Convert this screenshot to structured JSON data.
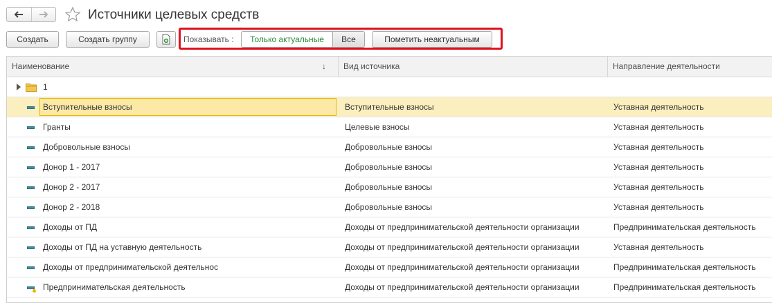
{
  "window": {
    "title": "Источники целевых средств",
    "icons": {
      "back": "arrow-left-icon",
      "forward": "arrow-right-icon",
      "favorite": "star-icon"
    }
  },
  "toolbar": {
    "create_label": "Создать",
    "create_group_label": "Создать группу",
    "copy_icon": "copy-document-icon",
    "show_label": "Показывать :",
    "filter_options": [
      "Только актуальные",
      "Все"
    ],
    "filter_selected": "Только актуальные",
    "mark_irrelevant_label": "Пометить неактуальным",
    "highlight_color": "#e0101e",
    "active_filter_color": "#2a8b3c"
  },
  "table": {
    "columns": [
      "Наименование",
      "Вид источника",
      "Направление деятельности"
    ],
    "sort_indicator": "↓",
    "group_row": {
      "label": "1",
      "icon": "folder-icon",
      "expander_icon": "triangle-right-icon"
    },
    "rows": [
      {
        "name": "Вступительные взносы",
        "source_type": "Вступительные взносы",
        "activity": "Уставная деятельность",
        "selected": true
      },
      {
        "name": "Гранты",
        "source_type": "Целевые взносы",
        "activity": "Уставная деятельность"
      },
      {
        "name": "Добровольные взносы",
        "source_type": "Добровольные взносы",
        "activity": "Уставная деятельность"
      },
      {
        "name": "Донор 1 - 2017",
        "source_type": "Добровольные взносы",
        "activity": "Уставная деятельность"
      },
      {
        "name": "Донор 2 - 2017",
        "source_type": "Добровольные взносы",
        "activity": "Уставная деятельность"
      },
      {
        "name": "Донор 2 - 2018",
        "source_type": "Добровольные взносы",
        "activity": "Уставная деятельность"
      },
      {
        "name": "Доходы от ПД",
        "source_type": "Доходы от предпринимательской деятельности организации",
        "activity": "Предпринимательская деятельность"
      },
      {
        "name": "Доходы от ПД на уставную деятельность",
        "source_type": "Доходы от предпринимательской деятельности организации",
        "activity": "Уставная деятельность"
      },
      {
        "name": "Доходы от предпринимательской деятельнос",
        "source_type": "Доходы от предпринимательской деятельности организации",
        "activity": "Предпринимательская деятельность"
      },
      {
        "name": "Предпринимательская деятельность",
        "source_type": "Доходы от предпринимательской деятельности организации",
        "activity": "Предпринимательская деятельность",
        "predefined": true
      }
    ],
    "selection_color": "#fbefbf",
    "item_icon": "catalog-item-icon"
  }
}
